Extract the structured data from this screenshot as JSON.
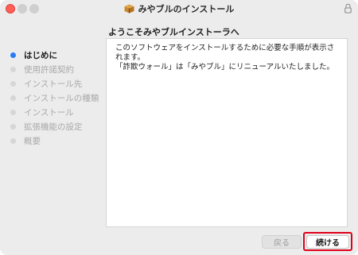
{
  "window": {
    "title": "みやブルのインストール",
    "icons": {
      "app": "package-icon",
      "lock": "lock-icon"
    }
  },
  "heading": "ようこそみやブルインストーラへ",
  "steps": [
    {
      "label": "はじめに",
      "active": true
    },
    {
      "label": "使用許諾契約",
      "active": false
    },
    {
      "label": "インストール先",
      "active": false
    },
    {
      "label": "インストールの種類",
      "active": false
    },
    {
      "label": "インストール",
      "active": false
    },
    {
      "label": "拡張機能の設定",
      "active": false
    },
    {
      "label": "概要",
      "active": false
    }
  ],
  "content": {
    "line1": "このソフトウェアをインストールするために必要な手順が表示されます。",
    "line2": "「詐欺ウォール」は「みやブル」にリニューアルいたしました。"
  },
  "buttons": {
    "back": "戻る",
    "continue": "続ける"
  },
  "colors": {
    "active_step": "#2a7bf6",
    "highlight_outline": "#e0001a",
    "close_button": "#ff5f57"
  }
}
